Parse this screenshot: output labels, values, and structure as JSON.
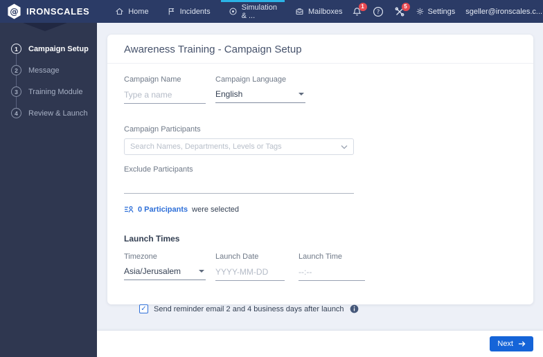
{
  "navbar": {
    "brand": "IRONSCALES",
    "items": [
      {
        "label": "Home"
      },
      {
        "label": "Incidents"
      },
      {
        "label": "Simulation & ..."
      },
      {
        "label": "Mailboxes"
      }
    ],
    "notifications_badge": "1",
    "tools_badge": "5",
    "settings_label": "Settings",
    "account_email": "sgeller@ironscales.c..."
  },
  "stepper": {
    "steps": [
      {
        "number": "1",
        "label": "Campaign Setup"
      },
      {
        "number": "2",
        "label": "Message"
      },
      {
        "number": "3",
        "label": "Training Module"
      },
      {
        "number": "4",
        "label": "Review & Launch"
      }
    ]
  },
  "page": {
    "title": "Awareness Training - Campaign Setup"
  },
  "form": {
    "campaign_name": {
      "label": "Campaign Name",
      "placeholder": "Type a name",
      "value": ""
    },
    "campaign_language": {
      "label": "Campaign Language",
      "value": "English"
    },
    "campaign_participants": {
      "label": "Campaign Participants",
      "placeholder": "Search Names, Departments, Levels or Tags"
    },
    "exclude_participants": {
      "label": "Exclude Participants",
      "value": ""
    },
    "participants_summary": {
      "count_text": "0 Participants",
      "suffix_text": "were selected"
    },
    "launch_times": {
      "heading": "Launch Times",
      "timezone": {
        "label": "Timezone",
        "value": "Asia/Jerusalem"
      },
      "launch_date": {
        "label": "Launch Date",
        "placeholder": "YYYY-MM-DD"
      },
      "launch_time": {
        "label": "Launch Time",
        "placeholder": "--:--"
      }
    },
    "reminder": {
      "label": "Send reminder email 2 and 4 business days after launch",
      "checked": true
    }
  },
  "footer": {
    "next_label": "Next"
  },
  "colors": {
    "navbar_bg": "#2b3b66",
    "sidebar_bg": "#2f3750",
    "active_tab_indicator": "#2bb3e6",
    "badge_red": "#e84a52",
    "link_blue": "#2e6fd8",
    "primary_button_blue": "#1564d8"
  }
}
